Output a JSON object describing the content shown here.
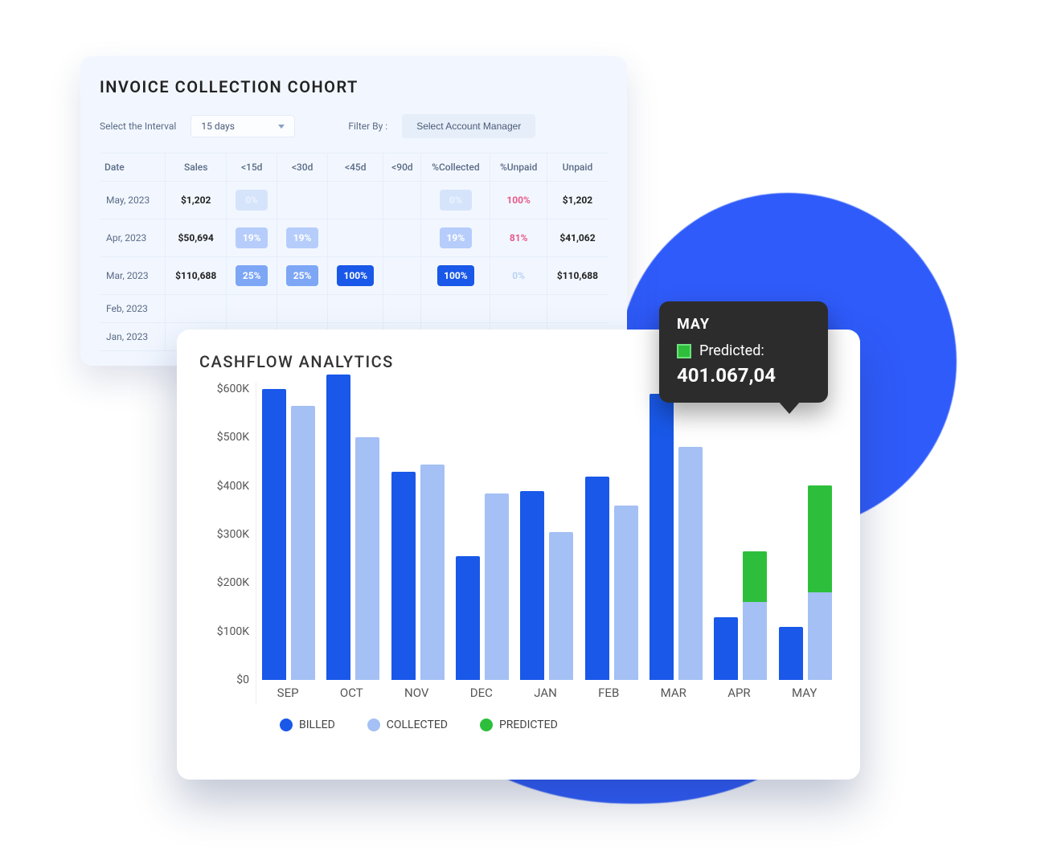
{
  "invoice": {
    "title": "INVOICE COLLECTION COHORT",
    "interval_label": "Select the Interval",
    "interval_value": "15 days",
    "filter_label": "Filter By :",
    "filter_value": "Select Account Manager",
    "columns": [
      "Date",
      "Sales",
      "<15d",
      "<30d",
      "<45d",
      "<90d",
      "%Collected",
      "%Unpaid",
      "Unpaid"
    ],
    "rows": [
      {
        "date": "May, 2023",
        "sales": "$1,202",
        "lt15": "0%",
        "lt30": "",
        "lt45": "",
        "lt90": "",
        "collected": "0%",
        "unpaid_pct": "100%",
        "unpaid": "$1,202",
        "lt15_cls": "faint",
        "collected_cls": "faint",
        "unpaid_pct_cls": "pct-unpaid"
      },
      {
        "date": "Apr, 2023",
        "sales": "$50,694",
        "lt15": "19%",
        "lt30": "19%",
        "lt45": "",
        "lt90": "",
        "collected": "19%",
        "unpaid_pct": "81%",
        "unpaid": "$41,062",
        "lt15_cls": "light",
        "lt30_cls": "light",
        "collected_cls": "light",
        "unpaid_pct_cls": "pct-unpaid"
      },
      {
        "date": "Mar, 2023",
        "sales": "$110,688",
        "lt15": "25%",
        "lt30": "25%",
        "lt45": "100%",
        "lt90": "",
        "collected": "100%",
        "unpaid_pct": "0%",
        "unpaid": "$110,688",
        "lt15_cls": "mid",
        "lt30_cls": "mid",
        "lt45_cls": "solid",
        "collected_cls": "solid",
        "unpaid_pct_cls": "pct-zero"
      },
      {
        "date": "Feb, 2023",
        "sales": "",
        "lt15": "",
        "lt30": "",
        "lt45": "",
        "lt90": "",
        "collected": "",
        "unpaid_pct": "",
        "unpaid": ""
      },
      {
        "date": "Jan, 2023",
        "sales": "",
        "lt15": "",
        "lt30": "",
        "lt45": "",
        "lt90": "",
        "collected": "",
        "unpaid_pct": "",
        "unpaid": ""
      }
    ]
  },
  "cashflow": {
    "title": "CASHFLOW ANALYTICS",
    "yticks": [
      "$600K",
      "$500K",
      "$400K",
      "$300K",
      "$200K",
      "$100K",
      "$0"
    ],
    "legend": {
      "billed": "BILLED",
      "collected": "COLLECTED",
      "predicted": "PREDICTED"
    }
  },
  "tooltip": {
    "month": "MAY",
    "label": "Predicted:",
    "value": "401.067,04"
  },
  "chart_data": {
    "type": "bar",
    "title": "CASHFLOW ANALYTICS",
    "xlabel": "",
    "ylabel": "",
    "ylim": [
      0,
      600000
    ],
    "yticks": [
      0,
      100000,
      200000,
      300000,
      400000,
      500000,
      600000
    ],
    "categories": [
      "SEP",
      "OCT",
      "NOV",
      "DEC",
      "JAN",
      "FEB",
      "MAR",
      "APR",
      "MAY"
    ],
    "series": [
      {
        "name": "BILLED",
        "color": "#1958e8",
        "values": [
          600000,
          630000,
          430000,
          255000,
          390000,
          420000,
          590000,
          130000,
          110000
        ]
      },
      {
        "name": "COLLECTED",
        "color": "#a4c0f4",
        "values": [
          565000,
          500000,
          445000,
          385000,
          305000,
          360000,
          480000,
          160000,
          180000
        ]
      },
      {
        "name": "PREDICTED",
        "color": "#2dbf3c",
        "values": [
          null,
          null,
          null,
          null,
          null,
          null,
          null,
          265000,
          401067.04
        ]
      }
    ],
    "legend_position": "bottom"
  }
}
